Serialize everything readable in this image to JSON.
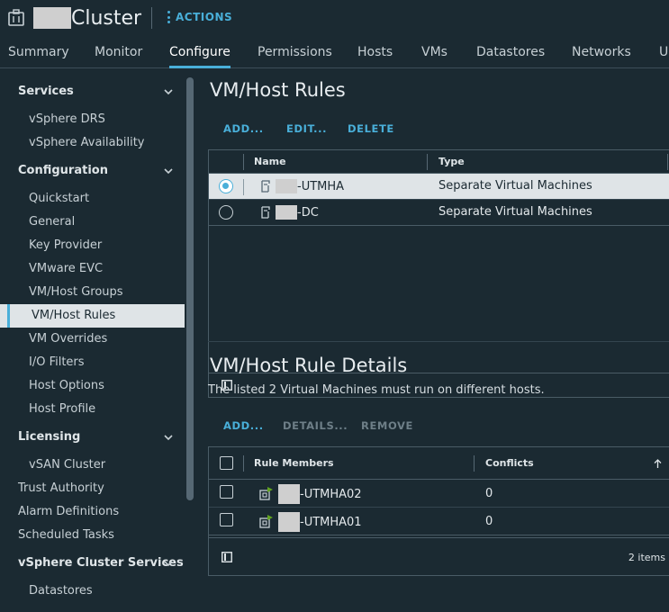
{
  "header": {
    "title": "Cluster",
    "actions_label": "ACTIONS"
  },
  "tabs": [
    {
      "label": "Summary",
      "active": false
    },
    {
      "label": "Monitor",
      "active": false
    },
    {
      "label": "Configure",
      "active": true
    },
    {
      "label": "Permissions",
      "active": false
    },
    {
      "label": "Hosts",
      "active": false
    },
    {
      "label": "VMs",
      "active": false
    },
    {
      "label": "Datastores",
      "active": false
    },
    {
      "label": "Networks",
      "active": false
    },
    {
      "label": "U",
      "active": false
    }
  ],
  "sidebar": {
    "items": [
      {
        "label": "Services",
        "kind": "section"
      },
      {
        "label": "vSphere DRS",
        "kind": "sub"
      },
      {
        "label": "vSphere Availability",
        "kind": "sub"
      },
      {
        "label": "Configuration",
        "kind": "section"
      },
      {
        "label": "Quickstart",
        "kind": "sub"
      },
      {
        "label": "General",
        "kind": "sub"
      },
      {
        "label": "Key Provider",
        "kind": "sub"
      },
      {
        "label": "VMware EVC",
        "kind": "sub"
      },
      {
        "label": "VM/Host Groups",
        "kind": "sub"
      },
      {
        "label": "VM/Host Rules",
        "kind": "active"
      },
      {
        "label": "VM Overrides",
        "kind": "sub"
      },
      {
        "label": "I/O Filters",
        "kind": "sub"
      },
      {
        "label": "Host Options",
        "kind": "sub"
      },
      {
        "label": "Host Profile",
        "kind": "sub"
      },
      {
        "label": "Licensing",
        "kind": "section"
      },
      {
        "label": "vSAN Cluster",
        "kind": "sub"
      },
      {
        "label": "Trust Authority",
        "kind": "top"
      },
      {
        "label": "Alarm Definitions",
        "kind": "top"
      },
      {
        "label": "Scheduled Tasks",
        "kind": "top"
      },
      {
        "label": "vSphere Cluster Services",
        "kind": "section"
      },
      {
        "label": "Datastores",
        "kind": "sub"
      }
    ]
  },
  "rules": {
    "title": "VM/Host Rules",
    "buttons": {
      "add": "ADD...",
      "edit": "EDIT...",
      "delete": "DELETE"
    },
    "columns": {
      "name": "Name",
      "type": "Type"
    },
    "rows": [
      {
        "name": "-UTMHA",
        "type": "Separate Virtual Machines",
        "selected": true
      },
      {
        "name": "-DC",
        "type": "Separate Virtual Machines",
        "selected": false
      }
    ]
  },
  "details": {
    "title": "VM/Host Rule Details",
    "description": "The listed 2 Virtual Machines must run on different hosts.",
    "buttons": {
      "add": "ADD...",
      "details": "DETAILS...",
      "remove": "REMOVE"
    },
    "columns": {
      "members": "Rule Members",
      "conflicts": "Conflicts"
    },
    "rows": [
      {
        "member": "-UTMHA02",
        "conflicts": "0"
      },
      {
        "member": "-UTMHA01",
        "conflicts": "0"
      }
    ],
    "footer_count": "2 items"
  },
  "icons": {
    "cluster": "cluster-icon",
    "rule": "rule-icon",
    "vm": "vm-icon",
    "chevron": "chevron-down-icon",
    "column_toggle": "column-toggle-icon",
    "sort": "sort-ascending-icon"
  },
  "colors": {
    "accent": "#49afd9",
    "background": "#1b2a32",
    "selected_row": "#dfe4e7"
  }
}
